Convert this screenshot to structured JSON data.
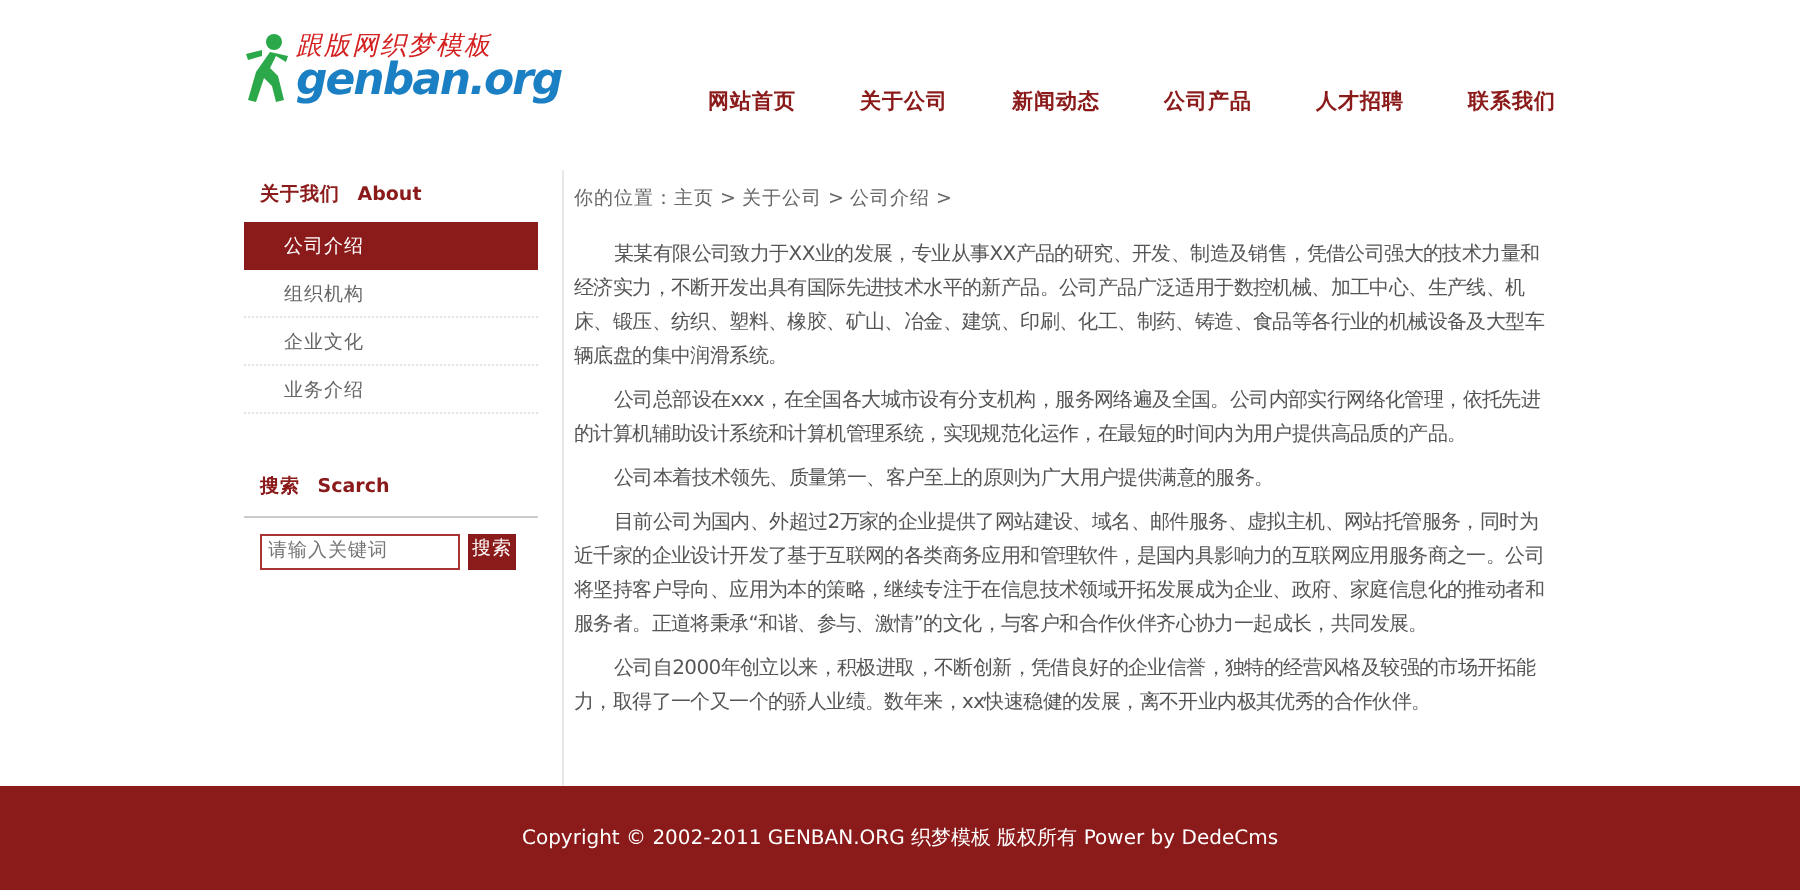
{
  "logo": {
    "tagline": "跟版网织梦模板",
    "wordmark": "genban.org"
  },
  "nav": [
    {
      "label": "网站首页"
    },
    {
      "label": "关于公司"
    },
    {
      "label": "新闻动态"
    },
    {
      "label": "公司产品"
    },
    {
      "label": "人才招聘"
    },
    {
      "label": "联系我们"
    }
  ],
  "sidebar": {
    "heading": "关于我们",
    "heading_en": "About",
    "items": [
      {
        "label": "公司介绍",
        "selected": true
      },
      {
        "label": "组织机构",
        "selected": false
      },
      {
        "label": "企业文化",
        "selected": false
      },
      {
        "label": "业务介绍",
        "selected": false
      }
    ],
    "search": {
      "heading": "搜索",
      "heading_en": "Scarch",
      "placeholder": "请输入关键词",
      "button": "搜索"
    }
  },
  "breadcrumb": "你的位置：主页 > 关于公司 > 公司介绍 >",
  "paragraphs": [
    "某某有限公司致力于XX业的发展，专业从事XX产品的研究、开发、制造及销售，凭借公司强大的技术力量和经济实力，不断开发出具有国际先进技术水平的新产品。公司产品广泛适用于数控机械、加工中心、生产线、机床、锻压、纺织、塑料、橡胶、矿山、冶金、建筑、印刷、化工、制药、铸造、食品等各行业的机械设备及大型车辆底盘的集中润滑系统。",
    "公司总部设在xxx，在全国各大城市设有分支机构，服务网络遍及全国。公司内部实行网络化管理，依托先进的计算机辅助设计系统和计算机管理系统，实现规范化运作，在最短的时间内为用户提供高品质的产品。",
    "公司本着技术领先、质量第一、客户至上的原则为广大用户提供满意的服务。",
    "目前公司为国内、外超过2万家的企业提供了网站建设、域名、邮件服务、虚拟主机、网站托管服务，同时为近千家的企业设计开发了基于互联网的各类商务应用和管理软件，是国内具影响力的互联网应用服务商之一。公司将坚持客户导向、应用为本的策略，继续专注于在信息技术领域开拓发展成为企业、政府、家庭信息化的推动者和服务者。正道将秉承“和谐、参与、激情”的文化，与客户和合作伙伴齐心协力一起成长，共同发展。",
    "公司自2000年创立以来，积极进取，不断创新，凭借良好的企业信誉，独特的经营风格及较强的市场开拓能力，取得了一个又一个的骄人业绩。数年来，xx快速稳健的发展，离不开业内极其优秀的合作伙伴。"
  ],
  "footer": "Copyright © 2002-2011 GENBAN.ORG 织梦模板 版权所有 Power by DedeCms"
}
